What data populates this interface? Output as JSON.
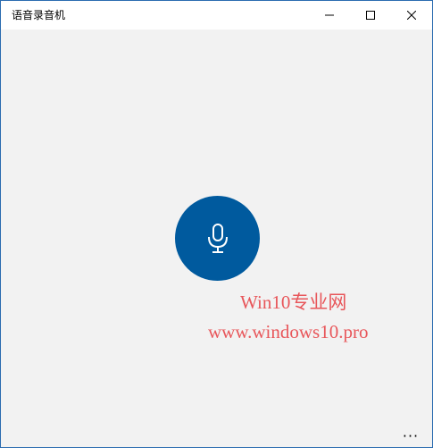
{
  "window": {
    "title": "语音录音机"
  },
  "controls": {
    "minimize_icon": "minimize-icon",
    "maximize_icon": "maximize-icon",
    "close_icon": "close-icon"
  },
  "main": {
    "record_icon": "microphone-icon",
    "accent_color": "#005a9e"
  },
  "watermark": {
    "line1": "Win10专业网",
    "line2": "www.windows10.pro",
    "color": "#e8565a"
  },
  "footer": {
    "more_label": "···"
  }
}
